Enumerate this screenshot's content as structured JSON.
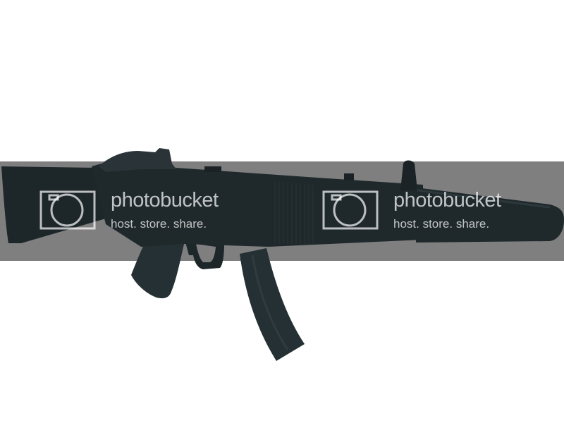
{
  "image": {
    "subject": "submachine-gun-with-suppressor",
    "background_color": "#ffffff",
    "band_color": "#7f7f7f",
    "weapon_color": "#1d2629",
    "weapon_highlight": "#2a3438"
  },
  "watermark": {
    "brand": "photobucket",
    "tagline": "host. store. share.",
    "repeat_count": 2,
    "color": "#ffffff"
  }
}
